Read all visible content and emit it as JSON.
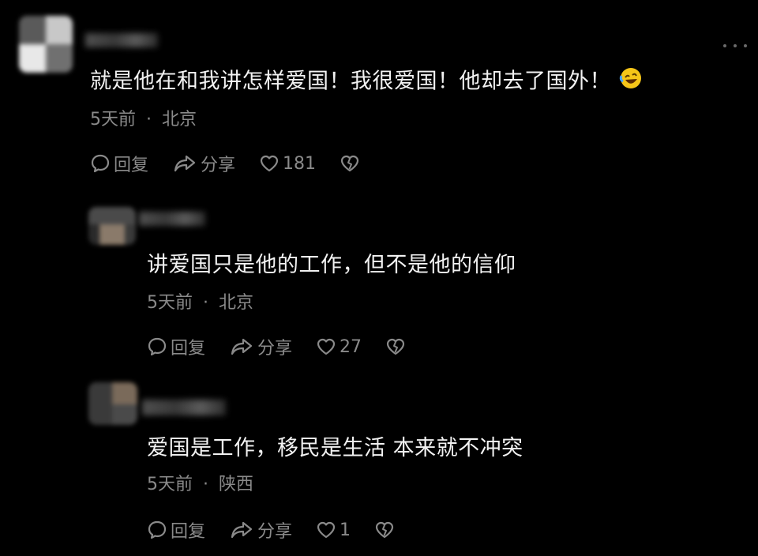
{
  "comments": [
    {
      "text": "就是他在和我讲怎样爱国！我很爱国！他却去了国外！",
      "emoji": "rolling-on-floor-laughing-emoji",
      "time": "5天前",
      "separator": "·",
      "location": "北京",
      "reply_label": "回复",
      "share_label": "分享",
      "likes": "181"
    },
    {
      "text": "讲爱国只是他的工作，但不是他的信仰",
      "time": "5天前",
      "separator": "·",
      "location": "北京",
      "reply_label": "回复",
      "share_label": "分享",
      "likes": "27"
    },
    {
      "text": "爱国是工作，移民是生活 本来就不冲突",
      "time": "5天前",
      "separator": "·",
      "location": "陕西",
      "reply_label": "回复",
      "share_label": "分享",
      "likes": "1"
    }
  ],
  "colors": {
    "background": "#000000",
    "primary_text": "#f2f2f2",
    "secondary_text": "#8a8a8a"
  }
}
